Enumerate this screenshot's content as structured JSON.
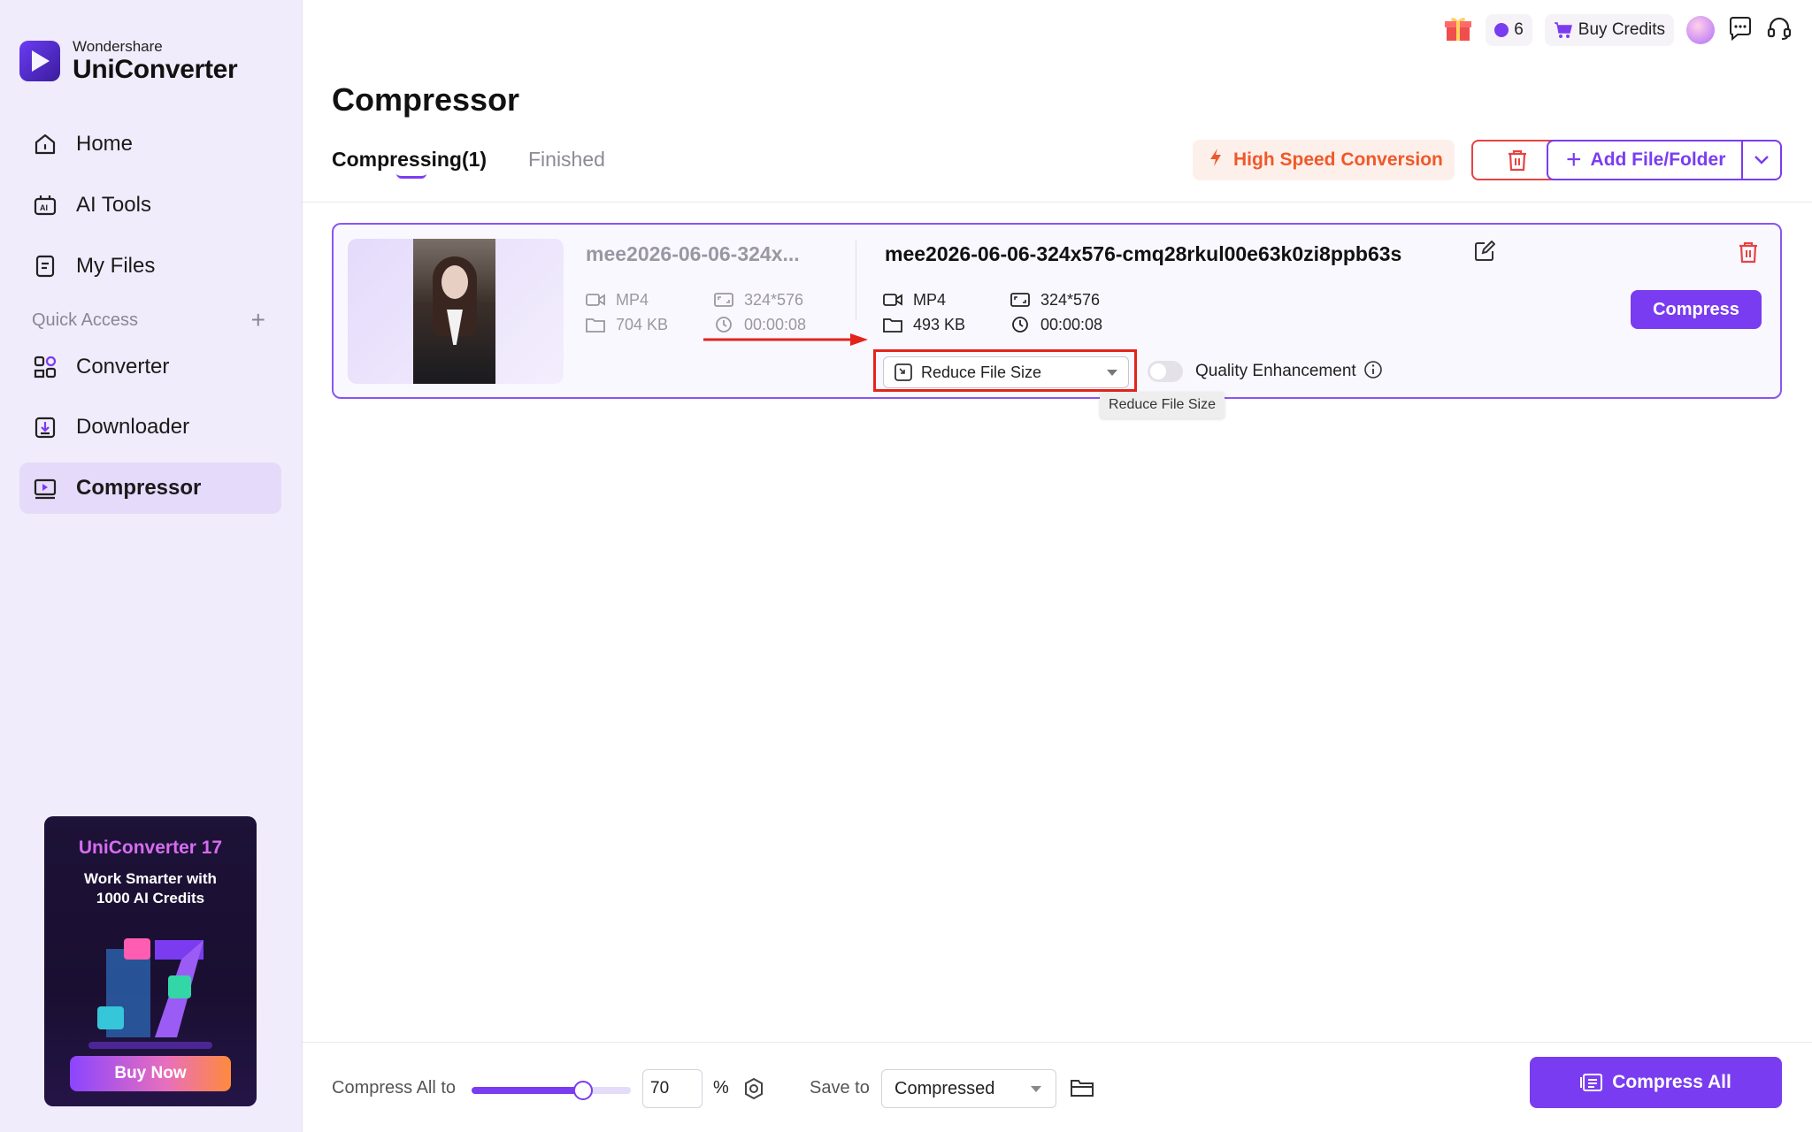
{
  "brand": {
    "company": "Wondershare",
    "product": "UniConverter"
  },
  "sidebar": {
    "items": [
      {
        "label": "Home",
        "icon": "home-icon"
      },
      {
        "label": "AI Tools",
        "icon": "ai-tools-icon"
      },
      {
        "label": "My Files",
        "icon": "files-icon"
      }
    ],
    "quick_access_label": "Quick Access",
    "quick_items": [
      {
        "label": "Converter",
        "icon": "converter-icon"
      },
      {
        "label": "Downloader",
        "icon": "downloader-icon"
      },
      {
        "label": "Compressor",
        "icon": "compressor-icon",
        "active": true
      }
    ]
  },
  "promo": {
    "title": "UniConverter 17",
    "subtitle_line1": "Work Smarter with",
    "subtitle_line2": "1000 AI Credits",
    "button": "Buy Now"
  },
  "topbar": {
    "credits": "6",
    "buy_credits": "Buy Credits"
  },
  "page": {
    "title": "Compressor",
    "tabs": [
      {
        "label": "Compressing(1)",
        "active": true
      },
      {
        "label": "Finished",
        "active": false
      }
    ],
    "high_speed": "High Speed Conversion",
    "add_file": "Add File/Folder"
  },
  "file": {
    "source": {
      "name": "mee2026-06-06-324x...",
      "format": "MP4",
      "resolution": "324*576",
      "size": "704 KB",
      "duration": "00:00:08"
    },
    "output": {
      "name": "mee2026-06-06-324x576-cmq28rkul00e63k0zi8ppb63s",
      "format": "MP4",
      "resolution": "324*576",
      "size": "493 KB",
      "duration": "00:00:08"
    },
    "mode": "Reduce File Size",
    "quality_enhancement_label": "Quality Enhancement",
    "quality_enhancement_on": false,
    "compress_button": "Compress",
    "tooltip": "Reduce File Size"
  },
  "bottom": {
    "compress_all_to_label": "Compress All to",
    "percent_value": "70",
    "percent_symbol": "%",
    "slider_level": 0.7,
    "save_to_label": "Save to",
    "save_to_value": "Compressed",
    "compress_all_button": "Compress All"
  },
  "colors": {
    "accent": "#7a3cf0",
    "danger": "#e64343",
    "highlight": "#e3241b",
    "speed": "#f0582a"
  }
}
